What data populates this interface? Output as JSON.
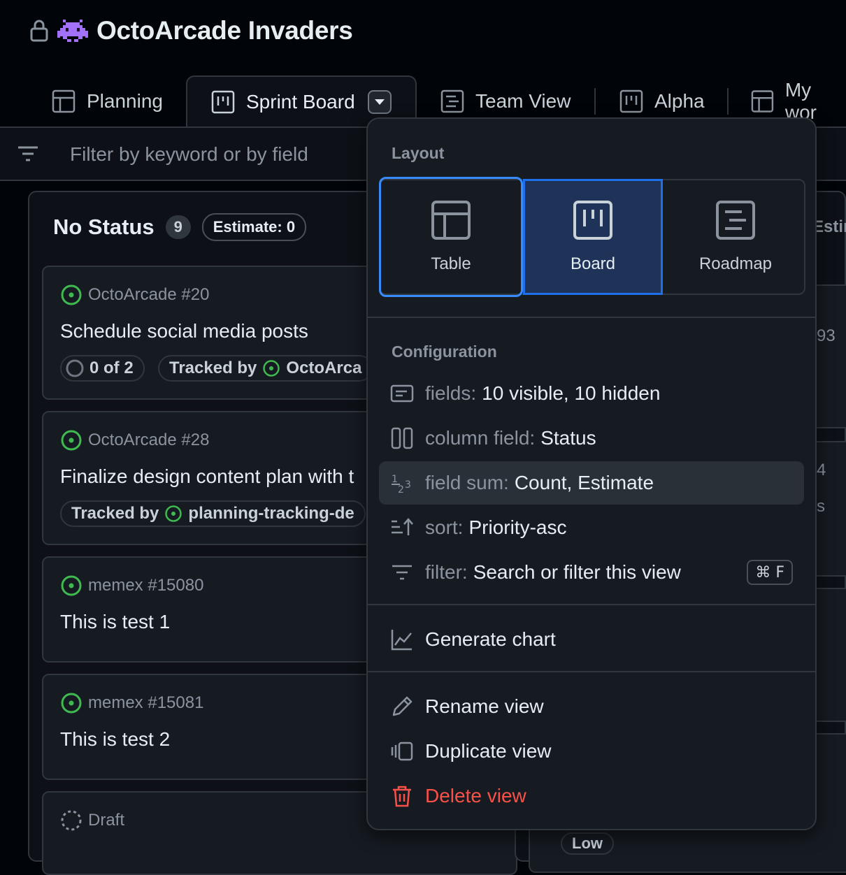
{
  "header": {
    "title": "OctoArcade Invaders"
  },
  "tabs": [
    {
      "label": "Planning",
      "icon": "table-icon"
    },
    {
      "label": "Sprint Board",
      "icon": "board-icon",
      "active": true
    },
    {
      "label": "Team View",
      "icon": "roadmap-icon"
    },
    {
      "label": "Alpha",
      "icon": "board-icon"
    },
    {
      "label": "My wor",
      "icon": "table-icon"
    }
  ],
  "filter": {
    "placeholder": "Filter by keyword or by field"
  },
  "column": {
    "title": "No Status",
    "count": "9",
    "estimate": "Estimate: 0"
  },
  "cards": [
    {
      "ref": "OctoArcade #20",
      "title": "Schedule social media posts",
      "progress": "0 of 2",
      "tracked_label": "Tracked by",
      "tracked_target": "OctoArca"
    },
    {
      "ref": "OctoArcade #28",
      "title": "Finalize design content plan with t",
      "tracked_label": "Tracked by",
      "tracked_target": "planning-tracking-de"
    },
    {
      "ref": "memex #15080",
      "title": "This is test 1"
    },
    {
      "ref": "memex #15081",
      "title": "This is test 2"
    },
    {
      "ref": "Draft"
    }
  ],
  "right_fragments": {
    "estimate": "Estir",
    "n1": "93",
    "n2": "4",
    "s": "s",
    "low": "Low"
  },
  "menu": {
    "layout_title": "Layout",
    "layouts": [
      {
        "label": "Table",
        "icon": "table-icon"
      },
      {
        "label": "Board",
        "icon": "board-icon",
        "selected": true
      },
      {
        "label": "Roadmap",
        "icon": "roadmap-icon"
      }
    ],
    "configuration_title": "Configuration",
    "config": [
      {
        "key": "fields:",
        "value": "10 visible, 10 hidden",
        "icon": "fields-icon"
      },
      {
        "key": "column field:",
        "value": "Status",
        "icon": "columns-icon"
      },
      {
        "key": "field sum:",
        "value": "Count, Estimate",
        "icon": "number-icon"
      },
      {
        "key": "sort:",
        "value": "Priority-asc",
        "icon": "sort-asc-icon"
      },
      {
        "key": "filter:",
        "value": "Search or filter this view",
        "icon": "filter-icon",
        "shortcut": "⌘ F"
      }
    ],
    "generate_chart": "Generate chart",
    "rename": "Rename view",
    "duplicate": "Duplicate view",
    "delete": "Delete view"
  },
  "colors": {
    "accent": "#1f6feb",
    "open": "#3fb950",
    "danger": "#f85149",
    "bg": "#010409",
    "surface": "#161b22"
  }
}
